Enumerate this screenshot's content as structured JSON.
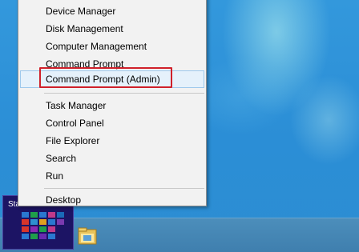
{
  "menu": {
    "items": [
      {
        "label": "Device Manager"
      },
      {
        "label": "Disk Management"
      },
      {
        "label": "Computer Management"
      },
      {
        "label": "Command Prompt"
      },
      {
        "label": "Command Prompt (Admin)"
      },
      {
        "label": "Task Manager"
      },
      {
        "label": "Control Panel"
      },
      {
        "label": "File Explorer"
      },
      {
        "label": "Search"
      },
      {
        "label": "Run"
      },
      {
        "label": "Desktop"
      }
    ]
  },
  "taskbar": {
    "start_label": "Start"
  },
  "colors": {
    "highlight": "#e5f1fb",
    "annotation": "#d0202a",
    "start_tile": "#1c1464"
  }
}
